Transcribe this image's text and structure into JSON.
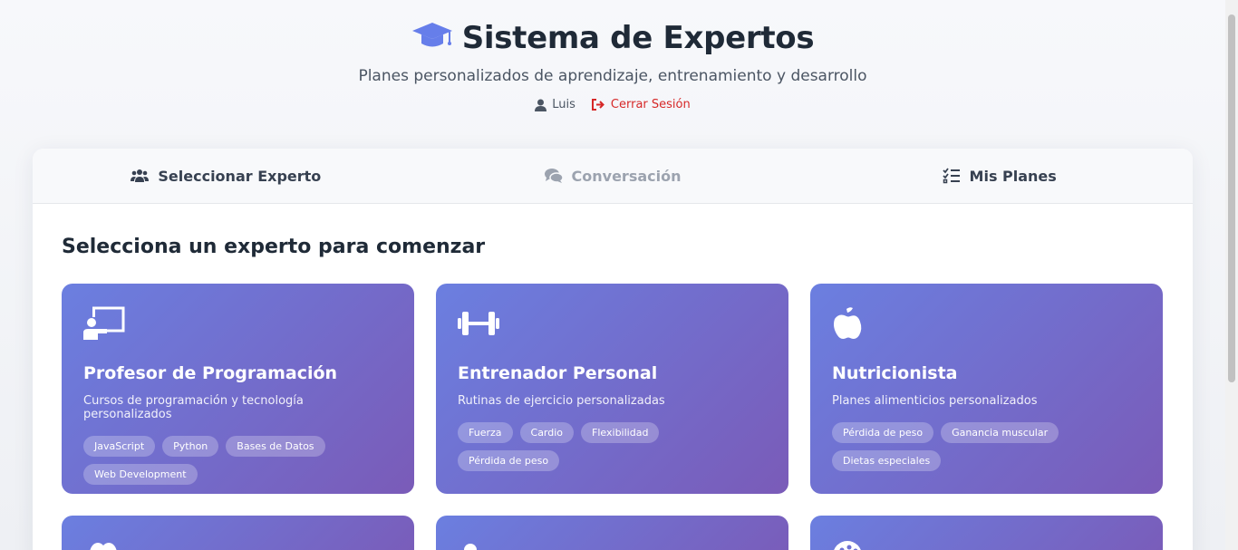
{
  "header": {
    "title": "Sistema de Expertos",
    "subtitle": "Planes personalizados de aprendizaje, entrenamiento y desarrollo",
    "user_name": "Luis",
    "logout_label": "Cerrar Sesión"
  },
  "tabs": [
    {
      "label": "Seleccionar Experto",
      "icon": "users-icon",
      "state": "active"
    },
    {
      "label": "Conversación",
      "icon": "comments-icon",
      "state": "disabled"
    },
    {
      "label": "Mis Planes",
      "icon": "checklist-icon",
      "state": "enabled"
    }
  ],
  "main": {
    "section_title": "Selecciona un experto para comenzar",
    "experts": [
      {
        "icon": "teacher-board-icon",
        "name": "Profesor de Programación",
        "description": "Cursos de programación y tecnología personalizados",
        "tags": [
          "JavaScript",
          "Python",
          "Bases de Datos",
          "Web Development"
        ]
      },
      {
        "icon": "dumbbell-icon",
        "name": "Entrenador Personal",
        "description": "Rutinas de ejercicio personalizadas",
        "tags": [
          "Fuerza",
          "Cardio",
          "Flexibilidad",
          "Pérdida de peso"
        ]
      },
      {
        "icon": "apple-icon",
        "name": "Nutricionista",
        "description": "Planes alimenticios personalizados",
        "tags": [
          "Pérdida de peso",
          "Ganancia muscular",
          "Dietas especiales"
        ]
      }
    ],
    "partial_cards": [
      {
        "icon": "brain-icon"
      },
      {
        "icon": "person-icon"
      },
      {
        "icon": "palette-icon"
      }
    ]
  },
  "colors": {
    "accent": "#667eea",
    "card_gradient_start": "#6b7fe0",
    "card_gradient_end": "#7a5bb8",
    "logout": "#d62828"
  }
}
